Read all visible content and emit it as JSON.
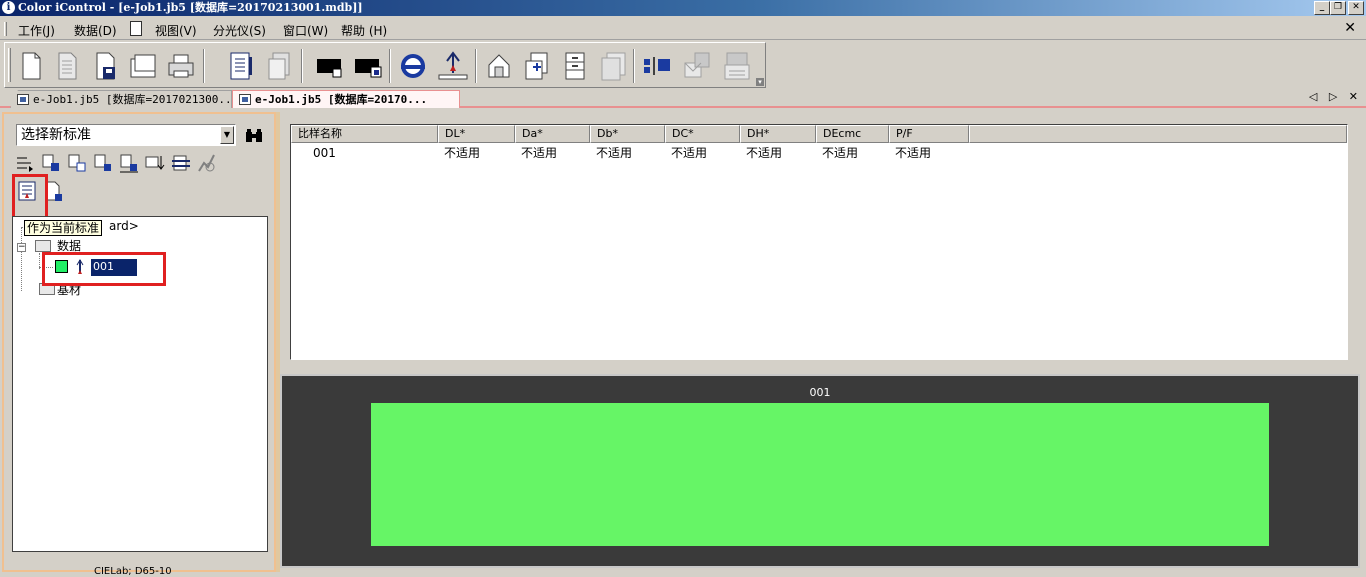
{
  "window": {
    "title": "Color iControl - [e-Job1.jb5 [数据库=20170213001.mdb]]",
    "app_icon": "info-icon",
    "controls": [
      "_",
      "❐",
      "✕"
    ]
  },
  "menubar": {
    "items": [
      "工作(J)",
      "数据(D)",
      "视图(V)",
      "分光仪(S)",
      "窗口(W)",
      "帮助 (H)"
    ],
    "close_glyph": "✕"
  },
  "toolbar": {
    "buttons": [
      "new-document-icon",
      "blank-page-icon",
      "save-icon",
      "batch-icon",
      "print-icon",
      "report-icon",
      "copy-report-icon",
      "black-swatch-icon",
      "black-swatch-edit-icon",
      "spectrometer-icon",
      "measure-icon",
      "home-icon",
      "import-icon",
      "file-cabinet-icon",
      "stacked-files-icon",
      "color-grid-icon",
      "palette-icon",
      "card-icon"
    ]
  },
  "tabs": [
    {
      "label": "e-Job1.jb5 [数据库=2017021300...",
      "active": false
    },
    {
      "label": "e-Job1.jb5 [数据库=20170...",
      "active": true
    }
  ],
  "tab_nav": "◁ ▷ ✕",
  "left_panel": {
    "standard_select": {
      "value": "选择新标准",
      "dropdown_glyph": "▼"
    },
    "find_glyph": "🔍",
    "tooltip": "作为当前标准",
    "tree": {
      "root_label_tail": "ard>",
      "group_data_label": "数据",
      "sample_label": "001",
      "group_substrate_label": "基材"
    },
    "status_text": "CIELab; D65-10"
  },
  "table": {
    "headers": [
      "比样名称",
      "DL*",
      "Da*",
      "Db*",
      "DC*",
      "DH*",
      "DEcmc",
      "P/F"
    ],
    "rows": [
      [
        "001",
        "不适用",
        "不适用",
        "不适用",
        "不适用",
        "不适用",
        "不适用",
        "不适用"
      ]
    ]
  },
  "preview": {
    "label": "001",
    "swatch_color": "#66f566"
  },
  "colors": {
    "highlight": "#e02020",
    "selection": "#0a246a",
    "sample_swatch": "#22ee66"
  }
}
